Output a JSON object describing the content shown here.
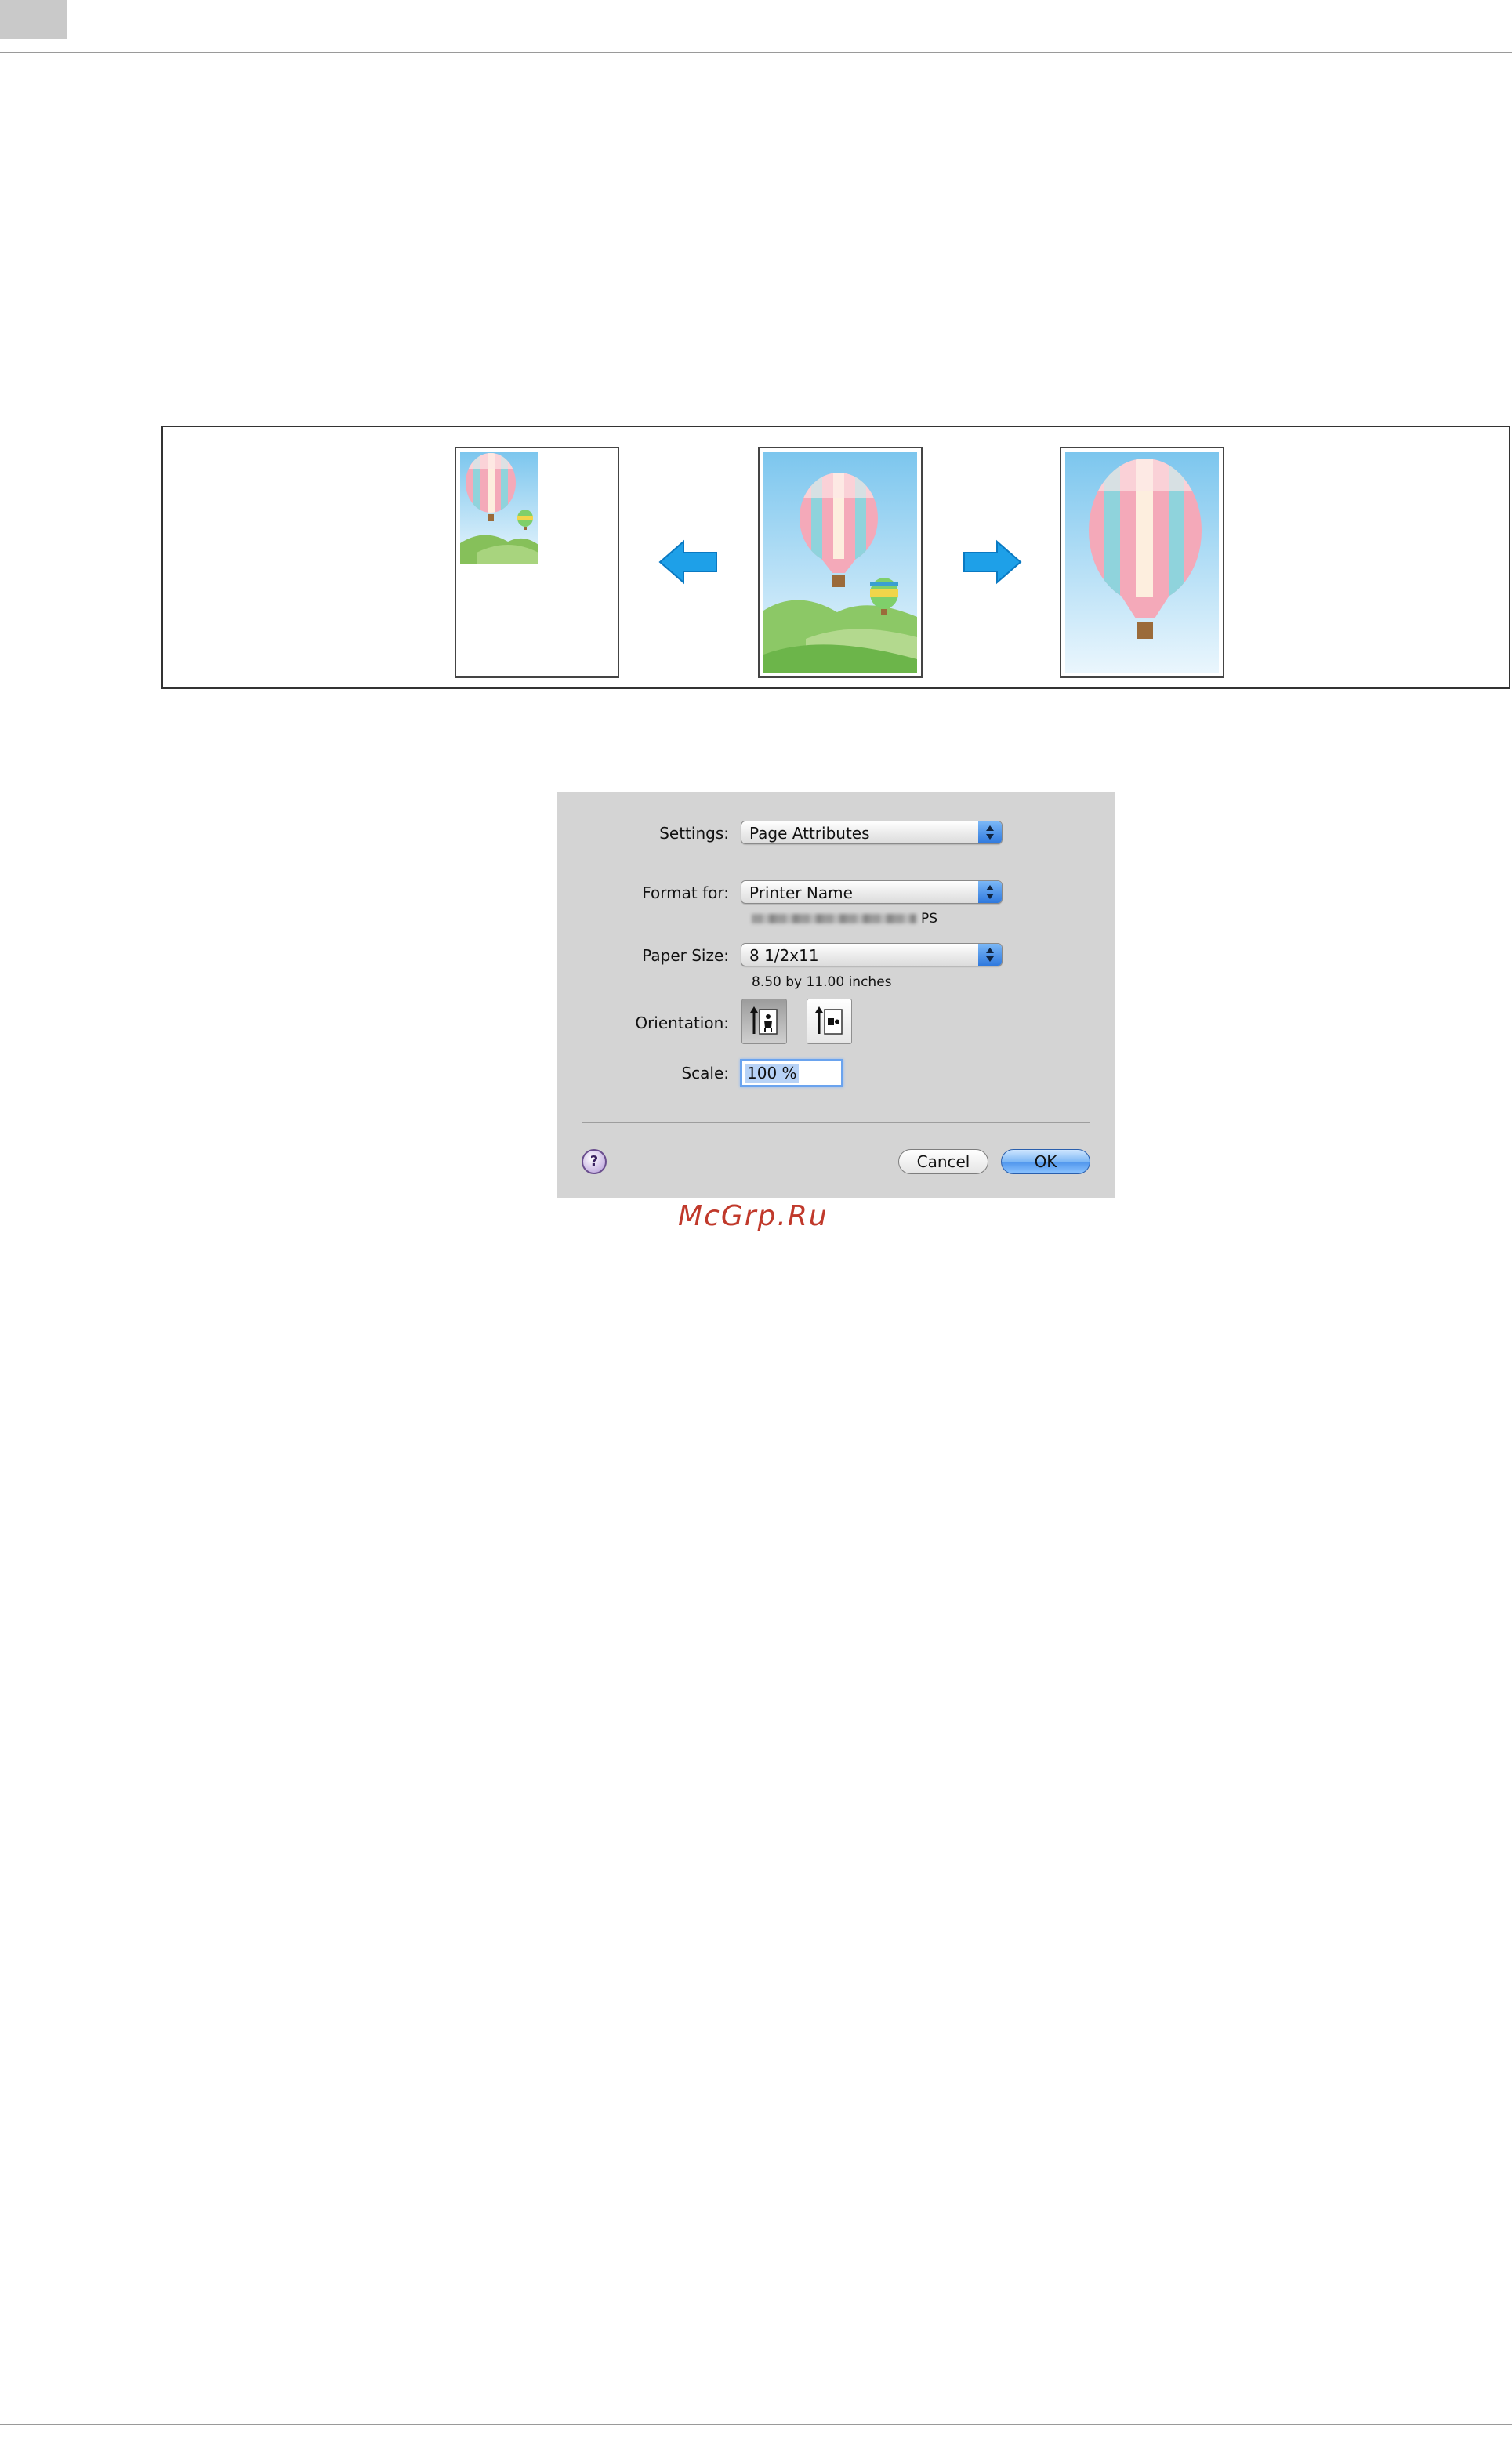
{
  "illustration": {
    "items": [
      "reduced-page",
      "original-page",
      "enlarged-page"
    ],
    "arrow_color": "#1ea0e8"
  },
  "dialog": {
    "settings": {
      "label": "Settings:",
      "value": "Page Attributes"
    },
    "format_for": {
      "label": "Format for:",
      "value": "Printer Name",
      "driver_suffix": "PS"
    },
    "paper_size": {
      "label": "Paper Size:",
      "value": "8 1/2x11",
      "dimensions": "8.50 by 11.00 inches"
    },
    "orientation": {
      "label": "Orientation:",
      "selected": "portrait",
      "options": [
        "portrait",
        "landscape"
      ]
    },
    "scale": {
      "label": "Scale:",
      "value": "100 %"
    },
    "help_label": "?",
    "cancel_label": "Cancel",
    "ok_label": "OK",
    "accent_color": "#4f95ec"
  },
  "watermark": "McGrp.Ru"
}
